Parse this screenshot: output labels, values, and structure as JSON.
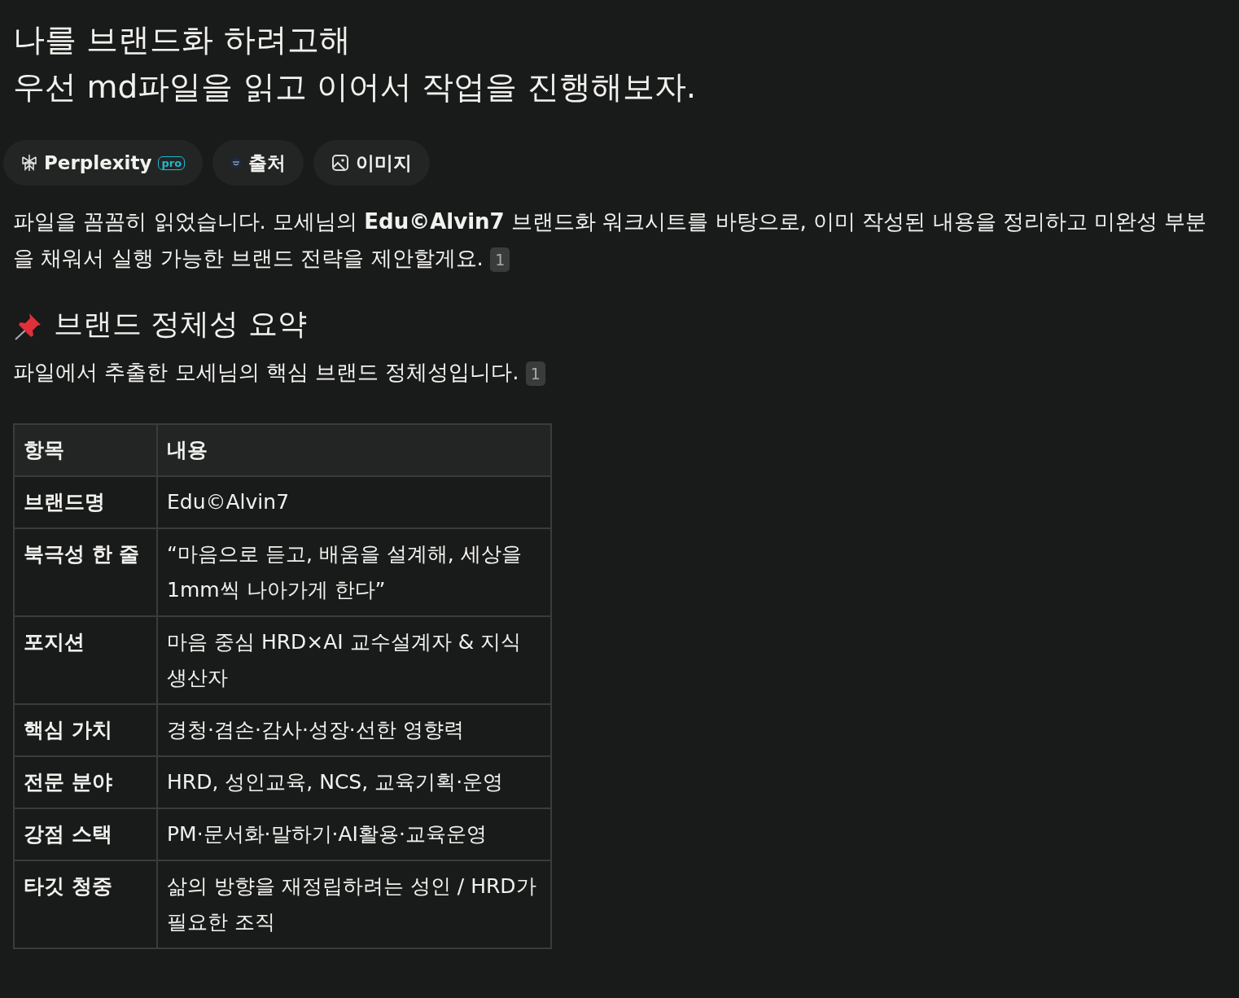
{
  "question": {
    "lines": [
      "나를 브랜드화 하려고해",
      "우선 md파일을 읽고 이어서 작업을 진행해보자."
    ]
  },
  "tabs": [
    {
      "kind": "perplexity",
      "label": "Perplexity",
      "badge": "pro"
    },
    {
      "kind": "sources",
      "label": "출처"
    },
    {
      "kind": "images",
      "label": "이미지"
    }
  ],
  "intro": {
    "text": "파일을 꼼꼼히 읽었습니다. 모세님의 **Edu©Alvin7** 브랜드화 워크시트를 바탕으로, 이미 작성된 내용을 정리하고 미완성 부분을 채워서 실행 가능한 브랜드 전략을 제안할게요.",
    "citation": "1"
  },
  "section": {
    "heading": "브랜드 정체성 요약",
    "text": "파일에서 추출한 모세님의 핵심 브랜드 정체성입니다.",
    "citation": "1"
  },
  "table": {
    "columns": [
      "항목",
      "내용"
    ],
    "rows": [
      [
        "브랜드명",
        "Edu©Alvin7"
      ],
      [
        "북극성 한 줄",
        "“마음으로 듣고, 배움을 설계해, 세상을 1mm씩 나아가게 한다”"
      ],
      [
        "포지션",
        "마음 중심 HRD×AI 교수설계자 & 지식 생산자"
      ],
      [
        "핵심 가치",
        "경청·겸손·감사·성장·선한 영향력"
      ],
      [
        "전문 분야",
        "HRD, 성인교육, NCS, 교육기획·운영"
      ],
      [
        "강점 스택",
        "PM·문서화·말하기·AI활용·교육운영"
      ],
      [
        "타깃 청중",
        "삶의 방향을 재정립하려는 성인 / HRD가 필요한 조직"
      ]
    ]
  }
}
